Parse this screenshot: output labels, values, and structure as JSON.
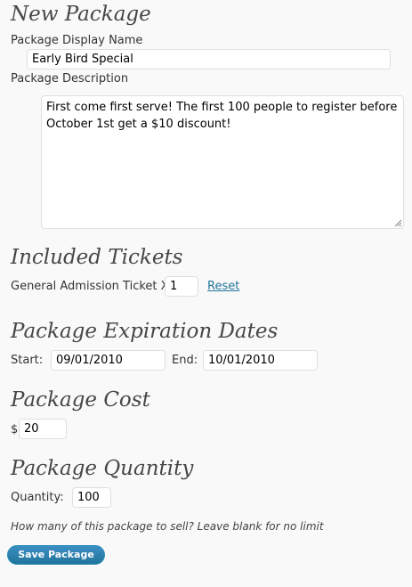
{
  "form_title": "New Package",
  "display_name": {
    "label": "Package Display Name",
    "value": "Early Bird Special"
  },
  "description": {
    "label": "Package Description",
    "value": "First come first serve! The first 100 people to register before October 1st get a $10 discount!"
  },
  "included_tickets": {
    "heading": "Included Tickets",
    "ticket_label": "General Admission Ticket X",
    "quantity_value": "1",
    "reset_label": "Reset"
  },
  "expiration": {
    "heading": "Package Expiration Dates",
    "start_label": "Start:",
    "start_value": "09/01/2010",
    "end_label": "End:",
    "end_value": "10/01/2010"
  },
  "cost": {
    "heading": "Package Cost",
    "currency_symbol": "$",
    "value": "20"
  },
  "quantity": {
    "heading": "Package Quantity",
    "label": "Quantity:",
    "value": "100",
    "hint": "How many of this package to sell? Leave blank for no limit"
  },
  "save_button_label": "Save Package",
  "colors": {
    "button": "#21759b",
    "link": "#21759b",
    "heading": "#464646"
  }
}
